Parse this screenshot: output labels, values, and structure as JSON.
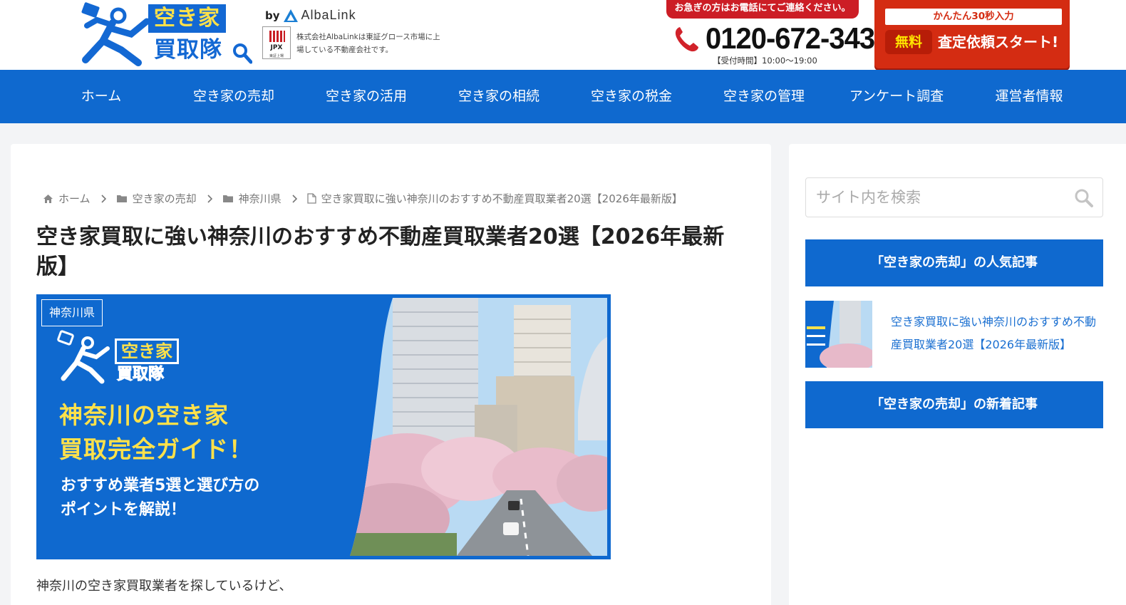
{
  "header": {
    "logo": {
      "word1": "空き家",
      "word2": "買取隊"
    },
    "by_label": "by",
    "brand": "AlbaLink",
    "jpx": {
      "mark": "JPX",
      "sub": "東証上場"
    },
    "listing_text": "株式会社AlbaLinkは東証グロース市場に上場している不動産会社です。",
    "urgent_text": "お急ぎの方はお電話にてご連絡ください。",
    "phone": "0120-672-343",
    "hours": "【受付時間】10:00〜19:00",
    "cta": {
      "top": "かんたん30秒入力",
      "badge": "無料",
      "main": "査定依頼スタート!"
    }
  },
  "nav": {
    "items": [
      {
        "label": "ホーム"
      },
      {
        "label": "空き家の売却"
      },
      {
        "label": "空き家の活用"
      },
      {
        "label": "空き家の相続"
      },
      {
        "label": "空き家の税金"
      },
      {
        "label": "空き家の管理"
      },
      {
        "label": "アンケート調査"
      },
      {
        "label": "運営者情報"
      }
    ]
  },
  "breadcrumb": {
    "items": [
      {
        "label": "ホーム",
        "icon": "home-icon"
      },
      {
        "label": "空き家の売却",
        "icon": "folder-icon"
      },
      {
        "label": "神奈川県",
        "icon": "folder-icon"
      },
      {
        "label": "空き家買取に強い神奈川のおすすめ不動産買取業者20選【2026年最新版】",
        "icon": "page-icon"
      }
    ]
  },
  "article": {
    "title": "空き家買取に強い神奈川のおすすめ不動産買取業者20選【2026年最新版】",
    "category": "神奈川県",
    "eyecatch": {
      "logo_word1a": "空き家",
      "logo_word2": "買取隊",
      "headline_1": "神奈川の空き家",
      "headline_2": "買取完全ガイド！",
      "sub_1": "おすすめ業者5選と選び方の",
      "sub_2": "ポイントを解説！"
    },
    "intro": "神奈川の空き家買取業者を探しているけど、"
  },
  "sidebar": {
    "search_placeholder": "サイト内を検索",
    "popular_title": "「空き家の売却」の人気記事",
    "popular_items": [
      {
        "title": "空き家買取に強い神奈川のおすすめ不動産買取業者20選【2026年最新版】"
      }
    ],
    "new_title": "「空き家の売却」の新着記事"
  },
  "colors": {
    "brand_blue": "#0f69cf",
    "accent_yellow": "#ffe14a",
    "cta_red": "#d42c12",
    "link_blue": "#1a6fd1"
  }
}
